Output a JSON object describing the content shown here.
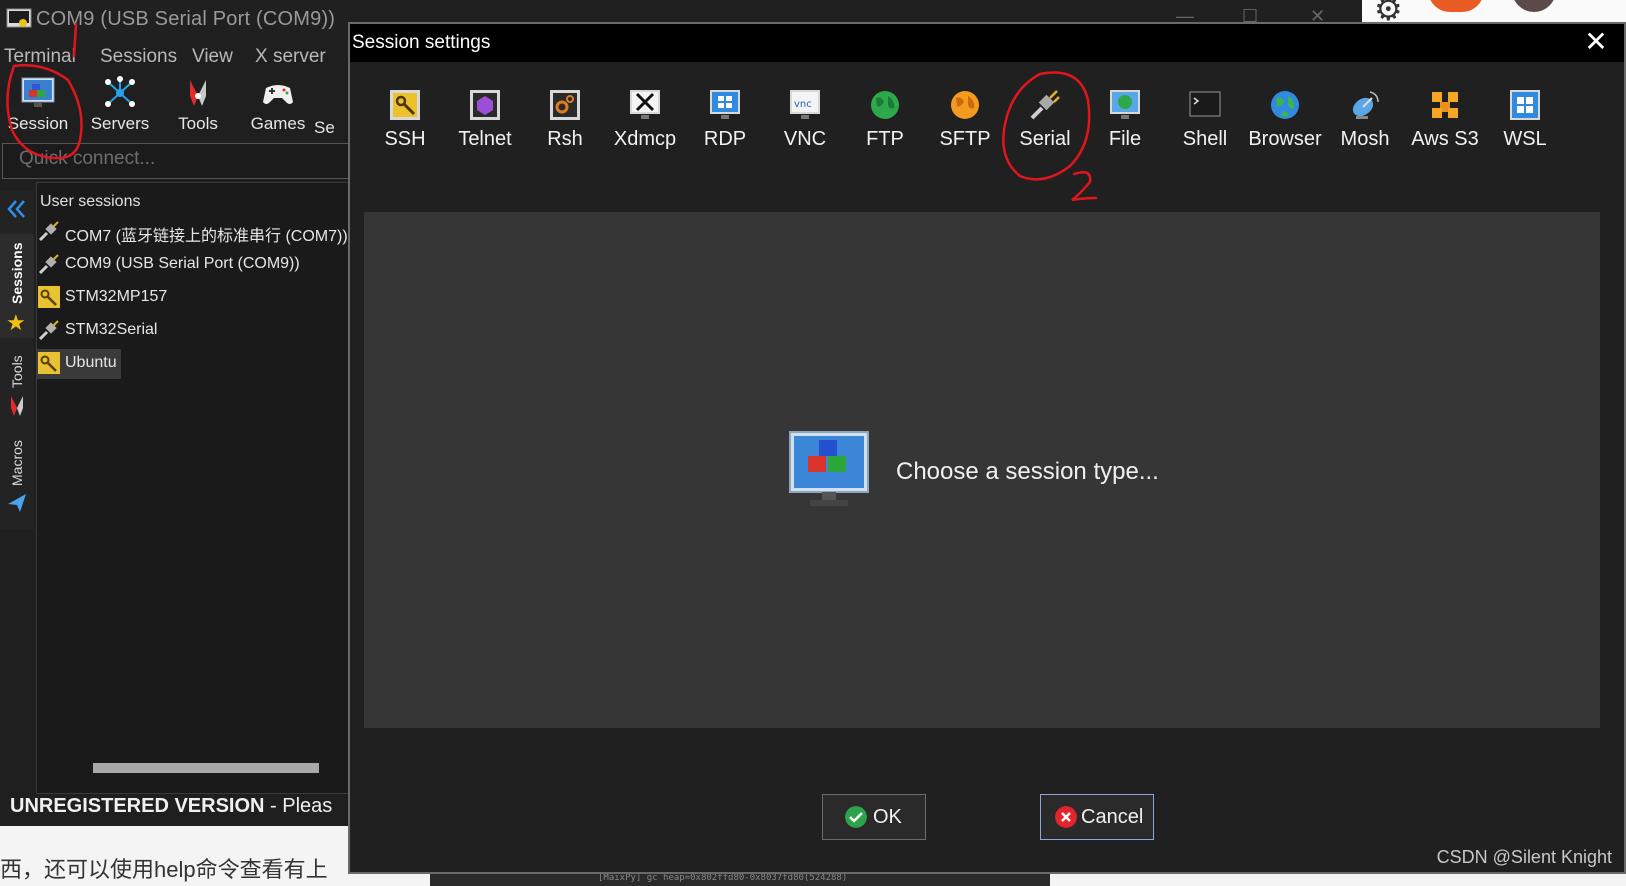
{
  "main_window": {
    "title": "COM9  (USB Serial Port (COM9))",
    "menu": [
      "Terminal",
      "Sessions",
      "View",
      "X server"
    ],
    "toolbar": [
      {
        "label": "Session",
        "icon": "session-icon"
      },
      {
        "label": "Servers",
        "icon": "servers-icon"
      },
      {
        "label": "Tools",
        "icon": "tools-icon"
      },
      {
        "label": "Games",
        "icon": "games-icon"
      },
      {
        "label": "Se",
        "icon": ""
      }
    ],
    "quick_connect_placeholder": "Quick connect...",
    "rail_tabs": [
      "Sessions",
      "Tools",
      "Macros"
    ],
    "sessions_header": "User sessions",
    "sessions": [
      {
        "label": "COM7  (蓝牙链接上的标准串行 (COM7))",
        "icon": "serial-plug-icon"
      },
      {
        "label": "COM9  (USB Serial Port (COM9))",
        "icon": "serial-plug-icon"
      },
      {
        "label": "STM32MP157",
        "icon": "ssh-key-icon"
      },
      {
        "label": "STM32Serial",
        "icon": "serial-plug-icon"
      },
      {
        "label": "Ubuntu",
        "icon": "ssh-key-icon",
        "selected": true
      }
    ],
    "unregistered": "UNREGISTERED VERSION",
    "unregistered_suffix": " -  Pleas"
  },
  "background_text": "西，还可以使用help命令查看有上",
  "background_console_strip": "[MaixPy] gc heap=0x802ffd80-0x8037fd80(524288)",
  "dialog": {
    "title": "Session settings",
    "session_types": [
      {
        "label": "SSH",
        "icon": "ssh-key-icon"
      },
      {
        "label": "Telnet",
        "icon": "telnet-icon"
      },
      {
        "label": "Rsh",
        "icon": "rsh-icon"
      },
      {
        "label": "Xdmcp",
        "icon": "xdmcp-icon"
      },
      {
        "label": "RDP",
        "icon": "rdp-icon"
      },
      {
        "label": "VNC",
        "icon": "vnc-icon"
      },
      {
        "label": "FTP",
        "icon": "ftp-globe-icon"
      },
      {
        "label": "SFTP",
        "icon": "sftp-globe-icon"
      },
      {
        "label": "Serial",
        "icon": "serial-plug-icon"
      },
      {
        "label": "File",
        "icon": "file-icon"
      },
      {
        "label": "Shell",
        "icon": "shell-icon"
      },
      {
        "label": "Browser",
        "icon": "browser-globe-icon"
      },
      {
        "label": "Mosh",
        "icon": "mosh-satellite-icon"
      },
      {
        "label": "Aws S3",
        "icon": "aws-s3-cubes-icon"
      },
      {
        "label": "WSL",
        "icon": "wsl-windows-icon"
      }
    ],
    "prompt": "Choose a session type...",
    "ok_label": "OK",
    "cancel_label": "Cancel"
  },
  "watermark": "CSDN @Silent Knight",
  "colors": {
    "annotation": "#e0161e",
    "ok_check": "#2ca24a",
    "cancel_x": "#e2242e"
  }
}
